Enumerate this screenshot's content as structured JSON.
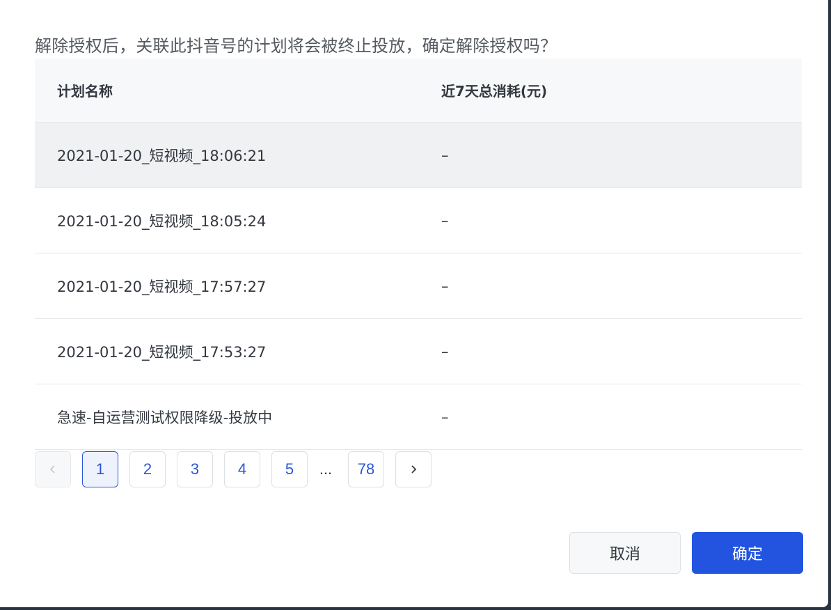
{
  "dialog": {
    "message": "解除授权后，关联此抖音号的计划将会被终止投放，确定解除授权吗？",
    "table": {
      "headers": [
        "计划名称",
        "近7天总消耗(元)"
      ],
      "rows": [
        {
          "name": "2021-01-20_短视频_18:06:21",
          "cost": "–"
        },
        {
          "name": "2021-01-20_短视频_18:05:24",
          "cost": "–"
        },
        {
          "name": "2021-01-20_短视频_17:57:27",
          "cost": "–"
        },
        {
          "name": "2021-01-20_短视频_17:53:27",
          "cost": "–"
        },
        {
          "name": "急速-自运营测试权限降级-投放中",
          "cost": "–"
        }
      ]
    },
    "pagination": {
      "pages": [
        "1",
        "2",
        "3",
        "4",
        "5"
      ],
      "ellipsis": "...",
      "last_page": "78",
      "current": "1"
    },
    "buttons": {
      "cancel": "取消",
      "confirm": "确定"
    }
  },
  "colors": {
    "primary": "#2254e0",
    "text": "#333840",
    "border": "#dcdfe4"
  }
}
